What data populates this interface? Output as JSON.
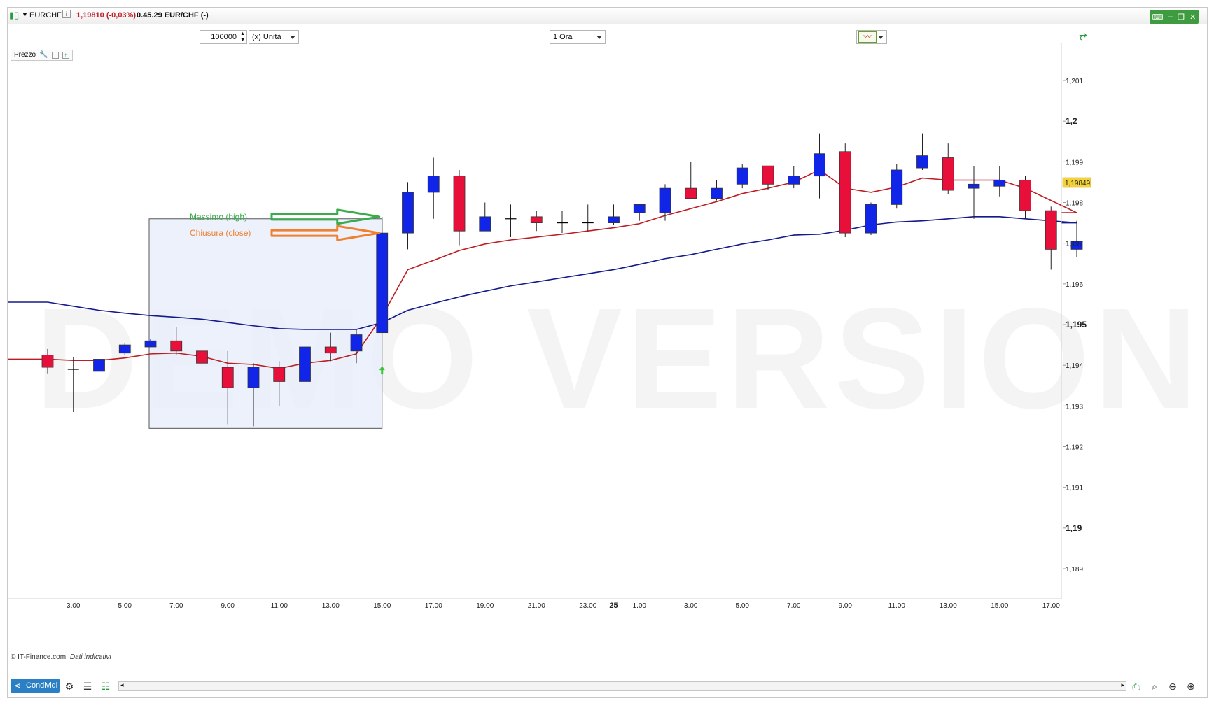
{
  "titlebar": {
    "symbol": "EURCHF",
    "info_icon": "info-icon",
    "price_change": "1,19810 (-0,03%)",
    "time_pair": "0.45.29 EUR/CHF (-)",
    "price_color": "#c0202b"
  },
  "toolbar": {
    "quantity_value": "100000",
    "unit_select": "(x) Unità",
    "timeframe_select": "1 Ora"
  },
  "panel": {
    "label": "Prezzo"
  },
  "footer": {
    "copyright": "© IT-Finance.com",
    "note": "Dati indicativi",
    "share_label": "Condividi"
  },
  "watermark": "DEMO VERSION",
  "colors": {
    "bull": "#1025e8",
    "bear": "#e8103a",
    "ma_fast": "#bd1d22",
    "ma_slow": "#14198c",
    "highlight_fill": "#e8edfb",
    "high_arrow": "#3aac4c",
    "close_arrow": "#f07f2e",
    "price_tag": "#f3d23a"
  },
  "chart_data": {
    "type": "candlestick",
    "symbol": "EURCHF",
    "timeframe": "1 Ora",
    "ylim": [
      1.1884,
      1.2016
    ],
    "y_ticks": [
      {
        "value": 1.189,
        "label": "1,189",
        "bold": false
      },
      {
        "value": 1.19,
        "label": "1,19",
        "bold": true
      },
      {
        "value": 1.191,
        "label": "1,191",
        "bold": false
      },
      {
        "value": 1.192,
        "label": "1,192",
        "bold": false
      },
      {
        "value": 1.193,
        "label": "1,193",
        "bold": false
      },
      {
        "value": 1.194,
        "label": "1,194",
        "bold": false
      },
      {
        "value": 1.195,
        "label": "1,195",
        "bold": true
      },
      {
        "value": 1.196,
        "label": "1,196",
        "bold": false
      },
      {
        "value": 1.197,
        "label": "1,197",
        "bold": false
      },
      {
        "value": 1.198,
        "label": "1,198",
        "bold": false
      },
      {
        "value": 1.199,
        "label": "1,199",
        "bold": false
      },
      {
        "value": 1.2,
        "label": "1,2",
        "bold": true
      },
      {
        "value": 1.201,
        "label": "1,201",
        "bold": false
      }
    ],
    "x_ticks": [
      {
        "index": 1,
        "label": "3.00",
        "bold": false
      },
      {
        "index": 3,
        "label": "5.00",
        "bold": false
      },
      {
        "index": 5,
        "label": "7.00",
        "bold": false
      },
      {
        "index": 7,
        "label": "9.00",
        "bold": false
      },
      {
        "index": 9,
        "label": "11.00",
        "bold": false
      },
      {
        "index": 11,
        "label": "13.00",
        "bold": false
      },
      {
        "index": 13,
        "label": "15.00",
        "bold": false
      },
      {
        "index": 15,
        "label": "17.00",
        "bold": false
      },
      {
        "index": 17,
        "label": "19.00",
        "bold": false
      },
      {
        "index": 19,
        "label": "21.00",
        "bold": false
      },
      {
        "index": 21,
        "label": "23.00",
        "bold": false
      },
      {
        "index": 22,
        "label": "25",
        "bold": true
      },
      {
        "index": 23,
        "label": "1.00",
        "bold": false
      },
      {
        "index": 25,
        "label": "3.00",
        "bold": false
      },
      {
        "index": 27,
        "label": "5.00",
        "bold": false
      },
      {
        "index": 29,
        "label": "7.00",
        "bold": false
      },
      {
        "index": 31,
        "label": "9.00",
        "bold": false
      },
      {
        "index": 33,
        "label": "11.00",
        "bold": false
      },
      {
        "index": 35,
        "label": "13.00",
        "bold": false
      },
      {
        "index": 37,
        "label": "15.00",
        "bold": false
      },
      {
        "index": 39,
        "label": "17.00",
        "bold": false
      }
    ],
    "candles": [
      {
        "o": 1.19425,
        "h": 1.1944,
        "l": 1.1938,
        "c": 1.19395
      },
      {
        "o": 1.1939,
        "h": 1.1942,
        "l": 1.19285,
        "c": 1.1939
      },
      {
        "o": 1.19385,
        "h": 1.19455,
        "l": 1.1938,
        "c": 1.19415
      },
      {
        "o": 1.1943,
        "h": 1.19455,
        "l": 1.19425,
        "c": 1.1945
      },
      {
        "o": 1.19445,
        "h": 1.19465,
        "l": 1.19445,
        "c": 1.1946
      },
      {
        "o": 1.1946,
        "h": 1.19495,
        "l": 1.19425,
        "c": 1.19435
      },
      {
        "o": 1.19435,
        "h": 1.1946,
        "l": 1.19375,
        "c": 1.19405
      },
      {
        "o": 1.19395,
        "h": 1.19435,
        "l": 1.19255,
        "c": 1.19345
      },
      {
        "o": 1.19345,
        "h": 1.19405,
        "l": 1.1925,
        "c": 1.19395
      },
      {
        "o": 1.19395,
        "h": 1.1941,
        "l": 1.193,
        "c": 1.1936
      },
      {
        "o": 1.1936,
        "h": 1.19485,
        "l": 1.1934,
        "c": 1.19445
      },
      {
        "o": 1.19445,
        "h": 1.1948,
        "l": 1.1941,
        "c": 1.1943
      },
      {
        "o": 1.19435,
        "h": 1.1949,
        "l": 1.19405,
        "c": 1.19475
      },
      {
        "o": 1.1948,
        "h": 1.19765,
        "l": 1.1948,
        "c": 1.19725
      },
      {
        "o": 1.19725,
        "h": 1.1985,
        "l": 1.19685,
        "c": 1.19825
      },
      {
        "o": 1.19825,
        "h": 1.1991,
        "l": 1.1976,
        "c": 1.19865
      },
      {
        "o": 1.19865,
        "h": 1.1988,
        "l": 1.19695,
        "c": 1.1973
      },
      {
        "o": 1.1973,
        "h": 1.198,
        "l": 1.1973,
        "c": 1.19765
      },
      {
        "o": 1.1976,
        "h": 1.19795,
        "l": 1.19715,
        "c": 1.1976
      },
      {
        "o": 1.19765,
        "h": 1.1978,
        "l": 1.1973,
        "c": 1.1975
      },
      {
        "o": 1.1975,
        "h": 1.1978,
        "l": 1.19725,
        "c": 1.1975
      },
      {
        "o": 1.1975,
        "h": 1.19795,
        "l": 1.1973,
        "c": 1.1975
      },
      {
        "o": 1.1975,
        "h": 1.19795,
        "l": 1.19745,
        "c": 1.19765
      },
      {
        "o": 1.19775,
        "h": 1.19795,
        "l": 1.19755,
        "c": 1.19795
      },
      {
        "o": 1.19775,
        "h": 1.19845,
        "l": 1.19755,
        "c": 1.19835
      },
      {
        "o": 1.19835,
        "h": 1.199,
        "l": 1.1981,
        "c": 1.1981
      },
      {
        "o": 1.1981,
        "h": 1.19855,
        "l": 1.19805,
        "c": 1.19835
      },
      {
        "o": 1.19845,
        "h": 1.19895,
        "l": 1.19835,
        "c": 1.19885
      },
      {
        "o": 1.1989,
        "h": 1.1989,
        "l": 1.1983,
        "c": 1.19845
      },
      {
        "o": 1.19845,
        "h": 1.1989,
        "l": 1.19835,
        "c": 1.19865
      },
      {
        "o": 1.19865,
        "h": 1.1997,
        "l": 1.1981,
        "c": 1.1992
      },
      {
        "o": 1.19925,
        "h": 1.19945,
        "l": 1.19715,
        "c": 1.19725
      },
      {
        "o": 1.19725,
        "h": 1.198,
        "l": 1.1972,
        "c": 1.19795
      },
      {
        "o": 1.19795,
        "h": 1.19895,
        "l": 1.19785,
        "c": 1.1988
      },
      {
        "o": 1.19885,
        "h": 1.1997,
        "l": 1.1988,
        "c": 1.19915
      },
      {
        "o": 1.1991,
        "h": 1.19945,
        "l": 1.1982,
        "c": 1.1983
      },
      {
        "o": 1.19835,
        "h": 1.1989,
        "l": 1.1976,
        "c": 1.19845
      },
      {
        "o": 1.1984,
        "h": 1.1989,
        "l": 1.19815,
        "c": 1.19855
      },
      {
        "o": 1.19855,
        "h": 1.19865,
        "l": 1.1976,
        "c": 1.1978
      },
      {
        "o": 1.1978,
        "h": 1.1979,
        "l": 1.19635,
        "c": 1.19685
      },
      {
        "o": 1.19685,
        "h": 1.19755,
        "l": 1.19665,
        "c": 1.19705
      }
    ],
    "series": [
      {
        "name": "",
        "color": "#bd1d22",
        "values": [
          1.19415,
          1.19412,
          1.19412,
          1.19418,
          1.19428,
          1.1943,
          1.19422,
          1.19405,
          1.19402,
          1.19392,
          1.19405,
          1.19412,
          1.19428,
          1.1952,
          1.19635,
          1.19658,
          1.19682,
          1.19698,
          1.19708,
          1.19715,
          1.19722,
          1.1973,
          1.19738,
          1.19748,
          1.19768,
          1.19785,
          1.19802,
          1.19822,
          1.19835,
          1.1985,
          1.1988,
          1.19835,
          1.19825,
          1.19838,
          1.1986,
          1.19855,
          1.19855,
          1.19855,
          1.19835,
          1.19805,
          1.19775
        ]
      },
      {
        "name": "",
        "color": "#14198c",
        "values": [
          1.19555,
          1.19545,
          1.19535,
          1.19528,
          1.19522,
          1.19518,
          1.19513,
          1.19505,
          1.19497,
          1.1949,
          1.19488,
          1.19488,
          1.19488,
          1.19505,
          1.19535,
          1.19552,
          1.19568,
          1.19582,
          1.19595,
          1.19605,
          1.19615,
          1.19625,
          1.19635,
          1.19648,
          1.19662,
          1.19672,
          1.19685,
          1.19698,
          1.19708,
          1.1972,
          1.19722,
          1.19732,
          1.19745,
          1.19752,
          1.19755,
          1.1976,
          1.19765,
          1.19765,
          1.1976,
          1.19755,
          1.1975
        ]
      }
    ],
    "current_price": {
      "value": 1.19849,
      "label": "1,19849"
    },
    "signal_arrow": {
      "index": 13,
      "value": 1.19388
    },
    "highlight_range": {
      "start_index": 4,
      "end_index": 13,
      "top": 1.1976,
      "bottom": 1.19245
    },
    "annotations": [
      {
        "text": "Massimo (high)",
        "value": 1.19765,
        "color": "#3aac4c"
      },
      {
        "text": "Chiusura (close)",
        "value": 1.19725,
        "color": "#f07f2e"
      }
    ]
  }
}
